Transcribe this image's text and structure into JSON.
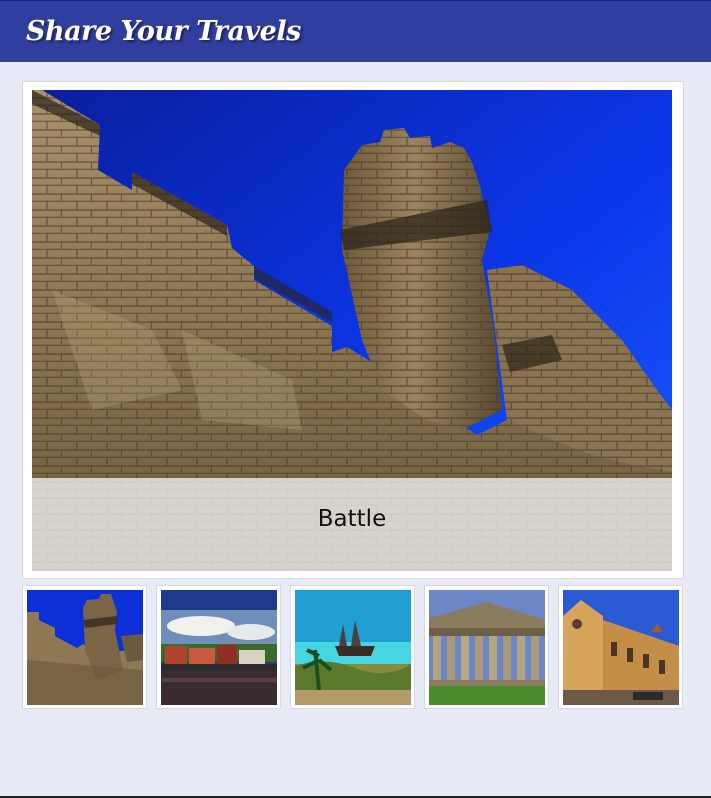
{
  "app": {
    "title": "Share Your Travels"
  },
  "featured": {
    "caption": "Battle",
    "image_icon": "castle-photo"
  },
  "thumbnails": [
    {
      "icon": "castle-photo"
    },
    {
      "icon": "harbor-town-photo"
    },
    {
      "icon": "pirate-ship-beach-photo"
    },
    {
      "icon": "greek-temple-photo"
    },
    {
      "icon": "church-facade-photo"
    }
  ],
  "colors": {
    "header": "#303f9f",
    "background": "#e8eaf6",
    "card": "#ffffff",
    "sky": "#0a2fd3"
  }
}
